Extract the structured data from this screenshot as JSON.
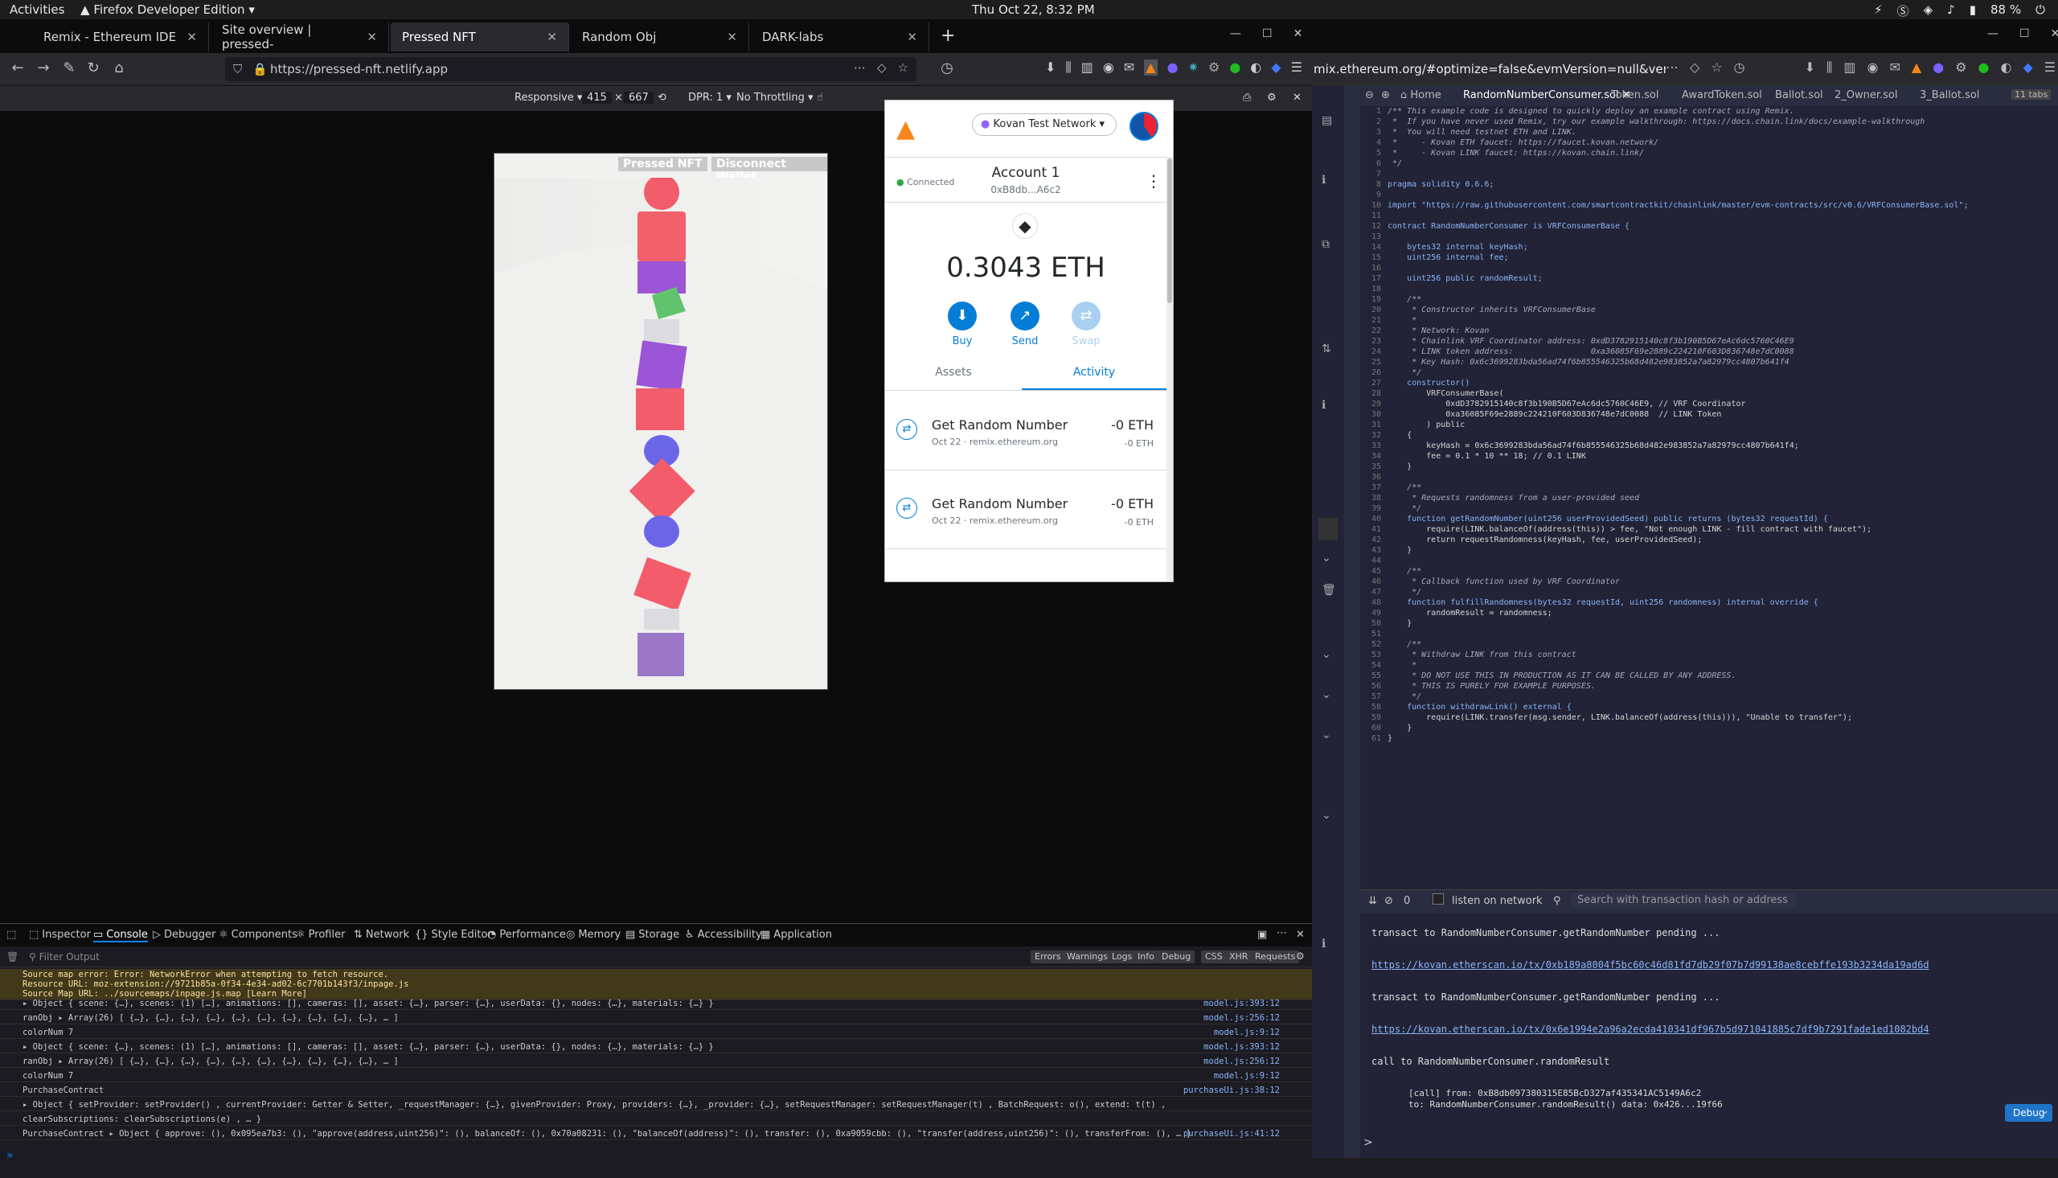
{
  "system": {
    "activities": "Activities",
    "browser_menu": "Firefox Developer Edition",
    "clock": "Thu Oct 22,  8:32 PM",
    "battery": "88 %"
  },
  "tabs": [
    {
      "label": "Remix - Ethereum IDE"
    },
    {
      "label": "Site overview | pressed-"
    },
    {
      "label": "Pressed NFT"
    },
    {
      "label": "Random Obj"
    },
    {
      "label": "DARK-labs"
    }
  ],
  "url": "https://pressed-nft.netlify.app",
  "rdm": {
    "mode": "Responsive",
    "width": "415",
    "height": "667",
    "dpr": "DPR: 1",
    "throttle": "No Throttling"
  },
  "site": {
    "pressed_label": "Pressed NFT",
    "disconnect_label": "Disconnect Wallet"
  },
  "metamask": {
    "network": "Kovan Test Network",
    "status": "Connected",
    "account": "Account 1",
    "address": "0xB8db...A6c2",
    "balance": "0.3043 ETH",
    "actions": {
      "buy": "Buy",
      "send": "Send",
      "swap": "Swap"
    },
    "tab_assets": "Assets",
    "tab_activity": "Activity",
    "activity": [
      {
        "title": "Get Random Number",
        "amount": "-0 ETH",
        "sub": "Oct 22 · remix.ethereum.org",
        "sub_amount": "-0 ETH"
      },
      {
        "title": "Get Random Number",
        "amount": "-0 ETH",
        "sub": "Oct 22 · remix.ethereum.org",
        "sub_amount": "-0 ETH"
      }
    ]
  },
  "devtools": {
    "tabs": [
      "Inspector",
      "Console",
      "Debugger",
      "Components",
      "Profiler",
      "Network",
      "Style Editor",
      "Performance",
      "Memory",
      "Storage",
      "Accessibility",
      "Application"
    ],
    "filter_placeholder": "Filter Output",
    "filters": [
      "Errors",
      "Warnings",
      "Logs",
      "Info",
      "Debug",
      "CSS",
      "XHR",
      "Requests"
    ],
    "console": [
      {
        "text": "Source map error: Error: NetworkError when attempting to fetch resource.",
        "src": "",
        "kind": "warn"
      },
      {
        "text": "Resource URL: moz-extension://9721b85a-0f34-4e34-ad02-6c7701b143f3/inpage.js",
        "src": "",
        "kind": "warn"
      },
      {
        "text": "Source Map URL: ../sourcemaps/inpage.js.map [Learn More]",
        "src": "",
        "kind": "warn"
      },
      {
        "text": "▸ Object { scene: {…}, scenes: (1) […], animations: [], cameras: [], asset: {…}, parser: {…}, userData: {}, nodes: {…}, materials: {…} }",
        "src": "model.js:393:12",
        "kind": ""
      },
      {
        "text": "ranObj ▸ Array(26) [ {…}, {…}, {…}, {…}, {…}, {…}, {…}, {…}, {…}, {…}, … ]",
        "src": "model.js:256:12",
        "kind": ""
      },
      {
        "text": "colorNum 7",
        "src": "model.js:9:12",
        "kind": ""
      },
      {
        "text": "▸ Object { scene: {…}, scenes: (1) […], animations: [], cameras: [], asset: {…}, parser: {…}, userData: {}, nodes: {…}, materials: {…} }",
        "src": "model.js:393:12",
        "kind": ""
      },
      {
        "text": "ranObj ▸ Array(26) [ {…}, {…}, {…}, {…}, {…}, {…}, {…}, {…}, {…}, {…}, … ]",
        "src": "model.js:256:12",
        "kind": ""
      },
      {
        "text": "colorNum 7",
        "src": "model.js:9:12",
        "kind": ""
      },
      {
        "text": "PurchaseContract",
        "src": "purchaseUi.js:38:12",
        "kind": ""
      },
      {
        "text": "▸ Object { setProvider: setProvider() , currentProvider: Getter & Setter, _requestManager: {…}, givenProvider: Proxy, providers: {…}, _provider: {…}, setRequestManager: setRequestManager(t) , BatchRequest: o(), extend: t(t) ,",
        "src": "",
        "kind": ""
      },
      {
        "text": "clearSubscriptions: clearSubscriptions(e) , … }",
        "src": "",
        "kind": ""
      },
      {
        "text": "PurchaseContract ▸ Object { approve: (), 0x095ea7b3: (), \"approve(address,uint256)\": (), balanceOf: (), 0x70a08231: (), \"balanceOf(address)\": (), transfer: (), 0xa9059cbb: (), \"transfer(address,uint256)\": (), transferFrom: (), … }",
        "src": "purchaseUi.js:41:12",
        "kind": ""
      }
    ]
  },
  "remix": {
    "url": "mix.ethereum.org/#optimize=false&evmVersion=null&vers",
    "tabs": [
      "Home",
      "RandomNumberConsumer.sol",
      "Token.sol",
      "AwardToken.sol",
      "Ballot.sol",
      "2_Owner.sol",
      "3_Ballot.sol"
    ],
    "tab_count": "11 tabs",
    "code": [
      "/** This example code is designed to quickly deploy an example contract using Remix.",
      " *  If you have never used Remix, try our example walkthrough: https://docs.chain.link/docs/example-walkthrough",
      " *  You will need testnet ETH and LINK.",
      " *     - Kovan ETH faucet: https://faucet.kovan.network/",
      " *     - Kovan LINK faucet: https://kovan.chain.link/",
      " */",
      "",
      "pragma solidity 0.6.6;",
      "",
      "import \"https://raw.githubusercontent.com/smartcontractkit/chainlink/master/evm-contracts/src/v0.6/VRFConsumerBase.sol\";",
      "",
      "contract RandomNumberConsumer is VRFConsumerBase {",
      "",
      "    bytes32 internal keyHash;",
      "    uint256 internal fee;",
      "",
      "    uint256 public randomResult;",
      "",
      "    /**",
      "     * Constructor inherits VRFConsumerBase",
      "     *",
      "     * Network: Kovan",
      "     * Chainlink VRF Coordinator address: 0xdD3782915140c8f3b190B5D67eAc6dc5760C46E9",
      "     * LINK token address:                0xa36085F69e2889c224210F603D836748e7dC0088",
      "     * Key Hash: 0x6c3699283bda56ad74f6b855546325b68d482e983852a7a82979cc4807b641f4",
      "     */",
      "    constructor()",
      "        VRFConsumerBase(",
      "            0xdD3782915140c8f3b190B5D67eAc6dc5760C46E9, // VRF Coordinator",
      "            0xa36085F69e2889c224210F603D836748e7dC0088  // LINK Token",
      "        ) public",
      "    {",
      "        keyHash = 0x6c3699283bda56ad74f6b855546325b68d482e983852a7a82979cc4807b641f4;",
      "        fee = 0.1 * 10 ** 18; // 0.1 LINK",
      "    }",
      "",
      "    /**",
      "     * Requests randomness from a user-provided seed",
      "     */",
      "    function getRandomNumber(uint256 userProvidedSeed) public returns (bytes32 requestId) {",
      "        require(LINK.balanceOf(address(this)) > fee, \"Not enough LINK - fill contract with faucet\");",
      "        return requestRandomness(keyHash, fee, userProvidedSeed);",
      "    }",
      "",
      "    /**",
      "     * Callback function used by VRF Coordinator",
      "     */",
      "    function fulfillRandomness(bytes32 requestId, uint256 randomness) internal override {",
      "        randomResult = randomness;",
      "    }",
      "",
      "    /**",
      "     * Withdraw LINK from this contract",
      "     *",
      "     * DO NOT USE THIS IN PRODUCTION AS IT CAN BE CALLED BY ANY ADDRESS.",
      "     * THIS IS PURELY FOR EXAMPLE PURPOSES.",
      "     */",
      "    function withdrawLink() external {",
      "        require(LINK.transfer(msg.sender, LINK.balanceOf(address(this))), \"Unable to transfer\");",
      "    }",
      "}"
    ],
    "terminal": {
      "count": "0",
      "listen_label": "listen on network",
      "search_placeholder": "Search with transaction hash or address",
      "lines": [
        {
          "text": "transact to RandomNumberConsumer.getRandomNumber pending ...",
          "link": false
        },
        {
          "text": "https://kovan.etherscan.io/tx/0xb189a8004f5bc60c46d81fd7db29f07b7d99138ae8cebffe193b3234da19ad6d",
          "link": true
        },
        {
          "text": "transact to RandomNumberConsumer.getRandomNumber pending ...",
          "link": false
        },
        {
          "text": "https://kovan.etherscan.io/tx/0x6e1994e2a96a2ecda410341df967b5d971041885c7df9b7291fade1ed1082bd4",
          "link": true
        },
        {
          "text": "call to RandomNumberConsumer.randomResult",
          "link": false
        },
        {
          "text": "[call] from: 0xB8db097380315E85BcD327af435341AC5149A6c2",
          "link": false
        },
        {
          "text": "to: RandomNumberConsumer.randomResult() data: 0x426...19f66",
          "link": false
        }
      ],
      "debug_label": "Debug"
    }
  }
}
